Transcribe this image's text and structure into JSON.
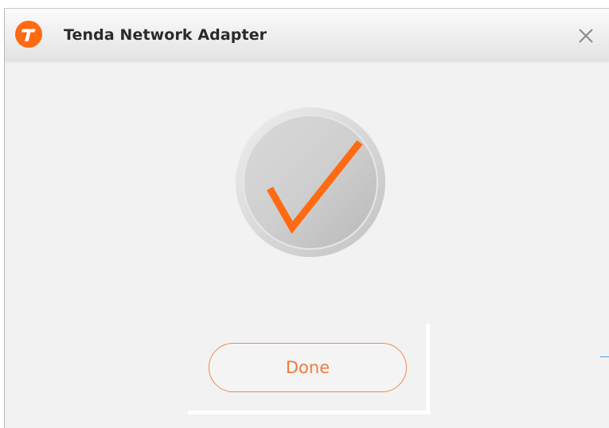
{
  "window": {
    "title": "Tenda Network Adapter"
  },
  "icons": {
    "logo": "tenda-logo-icon",
    "close": "close-icon",
    "success": "checkmark-icon"
  },
  "colors": {
    "brand_orange": "#ff6a13",
    "button_border": "#f0884a",
    "button_text": "#ee7b3f"
  },
  "actions": {
    "done_label": "Done"
  }
}
